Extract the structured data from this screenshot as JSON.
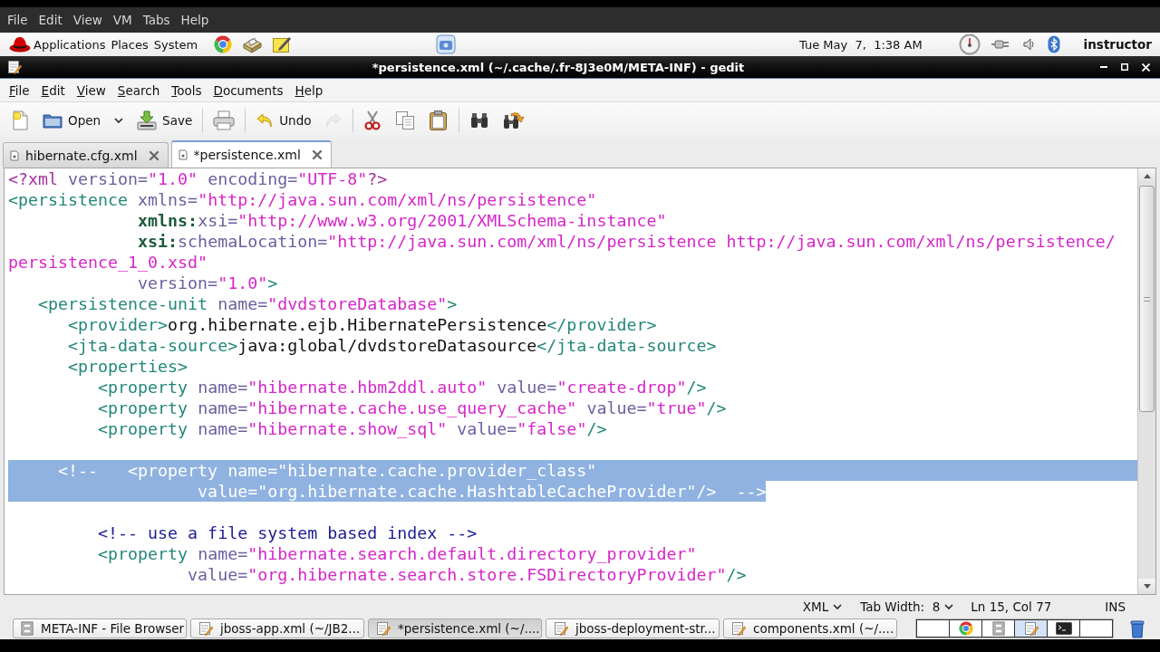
{
  "vm_menu": [
    "File",
    "Edit",
    "View",
    "VM",
    "Tabs",
    "Help"
  ],
  "top_panel": {
    "menus": [
      "Applications",
      "Places",
      "System"
    ],
    "clock": "Tue May  7,  1:38 AM",
    "user": "instructor"
  },
  "window": {
    "title": "*persistence.xml (~/.cache/.fr-8J3e0M/META-INF) - gedit"
  },
  "menu": [
    "File",
    "Edit",
    "View",
    "Search",
    "Tools",
    "Documents",
    "Help"
  ],
  "toolbar": [
    [
      {
        "kind": "new",
        "disabled": false
      },
      {
        "kind": "open",
        "label": "Open",
        "disabled": false
      },
      {
        "kind": "recent",
        "disabled": false
      },
      {
        "kind": "save",
        "label": "Save",
        "disabled": false
      }
    ],
    [
      {
        "kind": "print",
        "disabled": false
      }
    ],
    [
      {
        "kind": "undo",
        "label": "Undo",
        "disabled": false
      },
      {
        "kind": "redo",
        "disabled": true
      }
    ],
    [
      {
        "kind": "cut",
        "disabled": false
      },
      {
        "kind": "copy",
        "disabled": false
      },
      {
        "kind": "paste",
        "disabled": false
      }
    ],
    [
      {
        "kind": "find",
        "disabled": false
      },
      {
        "kind": "replace",
        "disabled": false
      }
    ]
  ],
  "tabs": [
    {
      "label": "hibernate.cfg.xml",
      "selected": false
    },
    {
      "label": "*persistence.xml",
      "selected": true
    }
  ],
  "editor": {
    "rows": [
      {
        "kind": "code",
        "eol_selected": false,
        "tokens": [
          {
            "kind": "pi",
            "text": "<?xml",
            "selected": false
          },
          {
            "kind": "attr",
            "text": " version=",
            "selected": false
          },
          {
            "kind": "value",
            "text": "\"1.0\"",
            "selected": false
          },
          {
            "kind": "attr",
            "text": " encoding=",
            "selected": false
          },
          {
            "kind": "value",
            "text": "\"UTF-8\"",
            "selected": false
          },
          {
            "kind": "pi",
            "text": "?>",
            "selected": false
          }
        ]
      },
      {
        "kind": "code",
        "eol_selected": false,
        "tokens": [
          {
            "kind": "tag",
            "text": "<persistence",
            "selected": false
          },
          {
            "kind": "attr",
            "text": " xmlns=",
            "selected": false
          },
          {
            "kind": "value",
            "text": "\"http://java.sun.com/xml/ns/persistence\"",
            "selected": false
          }
        ]
      },
      {
        "kind": "code",
        "eol_selected": false,
        "tokens": [
          {
            "kind": "ns",
            "text": "             xmlns:",
            "selected": false
          },
          {
            "kind": "attr",
            "text": "xsi=",
            "selected": false
          },
          {
            "kind": "value",
            "text": "\"http://www.w3.org/2001/XMLSchema-instance\"",
            "selected": false
          }
        ]
      },
      {
        "kind": "code",
        "eol_selected": false,
        "tokens": [
          {
            "kind": "ns",
            "text": "             xsi:",
            "selected": false
          },
          {
            "kind": "attr",
            "text": "schemaLocation=",
            "selected": false
          },
          {
            "kind": "value",
            "text": "\"http://java.sun.com/xml/ns/persistence http://java.sun.com/xml/ns/persistence/",
            "selected": false
          }
        ]
      },
      {
        "kind": "code",
        "eol_selected": false,
        "tokens": [
          {
            "kind": "value",
            "text": "persistence_1_0.xsd\"",
            "selected": false
          }
        ]
      },
      {
        "kind": "code",
        "eol_selected": false,
        "tokens": [
          {
            "kind": "attr",
            "text": "             version=",
            "selected": false
          },
          {
            "kind": "value",
            "text": "\"1.0\"",
            "selected": false
          },
          {
            "kind": "tag",
            "text": ">",
            "selected": false
          }
        ]
      },
      {
        "kind": "code",
        "eol_selected": false,
        "tokens": [
          {
            "kind": "tag",
            "text": "   <persistence-unit",
            "selected": false
          },
          {
            "kind": "attr",
            "text": " name=",
            "selected": false
          },
          {
            "kind": "value",
            "text": "\"dvdstoreDatabase\"",
            "selected": false
          },
          {
            "kind": "tag",
            "text": ">",
            "selected": false
          }
        ]
      },
      {
        "kind": "code",
        "eol_selected": false,
        "tokens": [
          {
            "kind": "tag",
            "text": "      <provider>",
            "selected": false
          },
          {
            "kind": "text",
            "text": "org.hibernate.ejb.HibernatePersistence",
            "selected": false
          },
          {
            "kind": "tag",
            "text": "</provider>",
            "selected": false
          }
        ]
      },
      {
        "kind": "code",
        "eol_selected": false,
        "tokens": [
          {
            "kind": "tag",
            "text": "      <jta-data-source>",
            "selected": false
          },
          {
            "kind": "text",
            "text": "java:global/dvdstoreDatasource",
            "selected": false
          },
          {
            "kind": "tag",
            "text": "</jta-data-source>",
            "selected": false
          }
        ]
      },
      {
        "kind": "code",
        "eol_selected": false,
        "tokens": [
          {
            "kind": "tag",
            "text": "      <properties>",
            "selected": false
          }
        ]
      },
      {
        "kind": "code",
        "eol_selected": false,
        "tokens": [
          {
            "kind": "tag",
            "text": "         <property",
            "selected": false
          },
          {
            "kind": "attr",
            "text": " name=",
            "selected": false
          },
          {
            "kind": "value",
            "text": "\"hibernate.hbm2ddl.auto\"",
            "selected": false
          },
          {
            "kind": "attr",
            "text": " value=",
            "selected": false
          },
          {
            "kind": "value",
            "text": "\"create-drop\"",
            "selected": false
          },
          {
            "kind": "tag",
            "text": "/>",
            "selected": false
          }
        ]
      },
      {
        "kind": "code",
        "eol_selected": false,
        "tokens": [
          {
            "kind": "tag",
            "text": "         <property",
            "selected": false
          },
          {
            "kind": "attr",
            "text": " name=",
            "selected": false
          },
          {
            "kind": "value",
            "text": "\"hibernate.cache.use_query_cache\"",
            "selected": false
          },
          {
            "kind": "attr",
            "text": " value=",
            "selected": false
          },
          {
            "kind": "value",
            "text": "\"true\"",
            "selected": false
          },
          {
            "kind": "tag",
            "text": "/>",
            "selected": false
          }
        ]
      },
      {
        "kind": "code",
        "eol_selected": false,
        "tokens": [
          {
            "kind": "tag",
            "text": "         <property",
            "selected": false
          },
          {
            "kind": "attr",
            "text": " name=",
            "selected": false
          },
          {
            "kind": "value",
            "text": "\"hibernate.show_sql\"",
            "selected": false
          },
          {
            "kind": "attr",
            "text": " value=",
            "selected": false
          },
          {
            "kind": "value",
            "text": "\"false\"",
            "selected": false
          },
          {
            "kind": "tag",
            "text": "/>",
            "selected": false
          }
        ]
      },
      {
        "kind": "blank"
      },
      {
        "kind": "code",
        "eol_selected": true,
        "tokens": [
          {
            "kind": "comment",
            "text": "     <!--   <property name=\"hibernate.cache.provider_class\"",
            "selected": true
          }
        ]
      },
      {
        "kind": "code",
        "eol_selected": false,
        "tokens": [
          {
            "kind": "comment",
            "text": "                   value=\"org.hibernate.cache.HashtableCacheProvider\"/>  -->",
            "selected": true
          }
        ]
      },
      {
        "kind": "blank"
      },
      {
        "kind": "code",
        "eol_selected": false,
        "tokens": [
          {
            "kind": "comment",
            "text": "         <!-- use a file system based index -->",
            "selected": false
          }
        ]
      },
      {
        "kind": "code",
        "eol_selected": false,
        "tokens": [
          {
            "kind": "tag",
            "text": "         <property",
            "selected": false
          },
          {
            "kind": "attr",
            "text": " name=",
            "selected": false
          },
          {
            "kind": "value",
            "text": "\"hibernate.search.default.directory_provider\"",
            "selected": false
          }
        ]
      },
      {
        "kind": "code",
        "eol_selected": false,
        "tokens": [
          {
            "kind": "attr",
            "text": "                  value=",
            "selected": false
          },
          {
            "kind": "value",
            "text": "\"org.hibernate.search.store.FSDirectoryProvider\"",
            "selected": false
          },
          {
            "kind": "tag",
            "text": "/>",
            "selected": false
          }
        ]
      }
    ]
  },
  "status_bar": {
    "language": "XML",
    "tab_width": "Tab Width:  8",
    "position": "Ln 15, Col 77",
    "mode": "INS"
  },
  "taskbar": {
    "windows": [
      {
        "kind": "files",
        "label": "META-INF - File Browser",
        "selected": false
      },
      {
        "kind": "editor",
        "label": "jboss-app.xml (~/JB2...",
        "selected": false
      },
      {
        "kind": "editor",
        "label": "*persistence.xml (~/....",
        "selected": true
      },
      {
        "kind": "editor",
        "label": "jboss-deployment-str...",
        "selected": false
      },
      {
        "kind": "editor",
        "label": "components.xml (~/....",
        "selected": false
      }
    ],
    "workspaces": [
      {
        "kind": "empty",
        "selected": false
      },
      {
        "kind": "browser",
        "selected": false
      },
      {
        "kind": "files",
        "selected": false
      },
      {
        "kind": "editor",
        "selected": true
      },
      {
        "kind": "terminal",
        "selected": false
      },
      {
        "kind": "empty",
        "selected": false
      }
    ]
  }
}
